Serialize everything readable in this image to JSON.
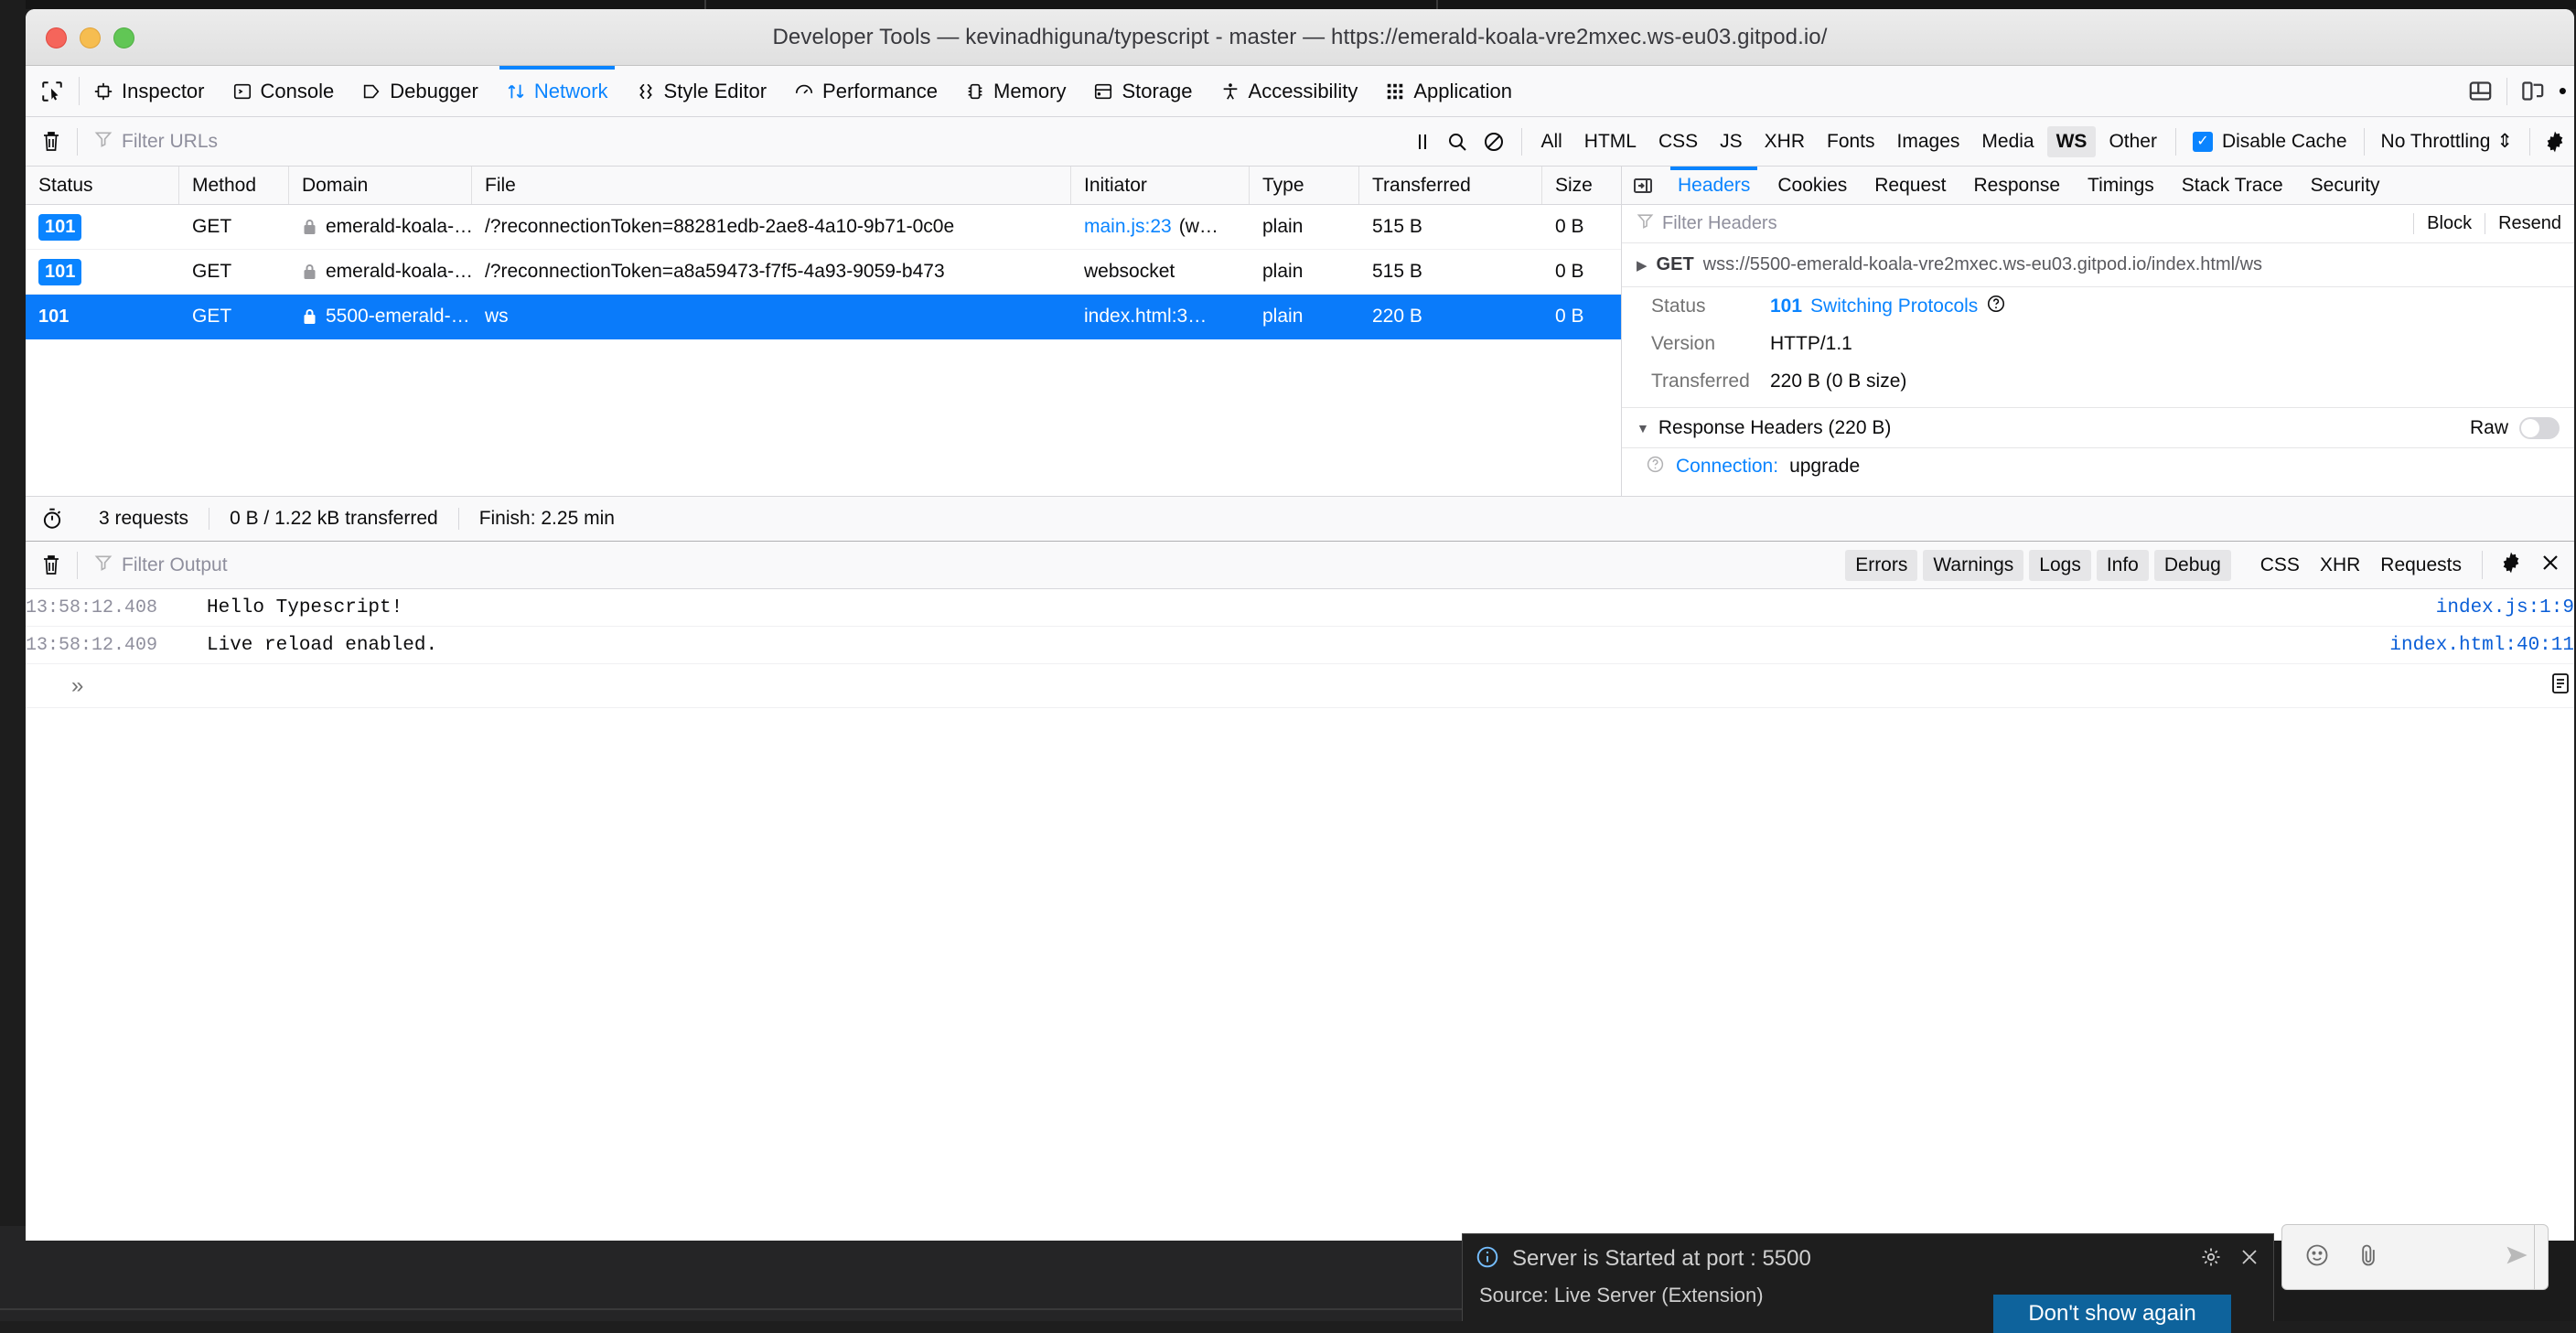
{
  "window": {
    "title": "Developer Tools — kevinadhiguna/typescript - master — https://emerald-koala-vre2mxec.ws-eu03.gitpod.io/",
    "traffic_lights": {
      "close": "close",
      "minimize": "minimize",
      "maximize": "maximize"
    }
  },
  "toolbar": {
    "picker_icon": "element-picker-icon",
    "tabs": [
      {
        "label": "Inspector",
        "icon": "inspector-icon",
        "active": false
      },
      {
        "label": "Console",
        "icon": "console-icon",
        "active": false
      },
      {
        "label": "Debugger",
        "icon": "debugger-icon",
        "active": false
      },
      {
        "label": "Network",
        "icon": "network-icon",
        "active": true
      },
      {
        "label": "Style Editor",
        "icon": "style-editor-icon",
        "active": false
      },
      {
        "label": "Performance",
        "icon": "performance-icon",
        "active": false
      },
      {
        "label": "Memory",
        "icon": "memory-icon",
        "active": false
      },
      {
        "label": "Storage",
        "icon": "storage-icon",
        "active": false
      },
      {
        "label": "Accessibility",
        "icon": "accessibility-icon",
        "active": false
      },
      {
        "label": "Application",
        "icon": "application-icon",
        "active": false
      }
    ],
    "right_icons": [
      "dock-layout-icon",
      "responsive-design-mode-icon",
      "more-options-icon"
    ],
    "accent_color": "#0a84ff"
  },
  "network_filterbar": {
    "clear_icon": "trash-icon",
    "filter_placeholder": "Filter URLs",
    "tools": [
      "pause-icon",
      "search-icon",
      "block-icon"
    ],
    "type_filters": [
      {
        "label": "All",
        "active": false
      },
      {
        "label": "HTML",
        "active": false
      },
      {
        "label": "CSS",
        "active": false
      },
      {
        "label": "JS",
        "active": false
      },
      {
        "label": "XHR",
        "active": false
      },
      {
        "label": "Fonts",
        "active": false
      },
      {
        "label": "Images",
        "active": false
      },
      {
        "label": "Media",
        "active": false
      },
      {
        "label": "WS",
        "active": true
      },
      {
        "label": "Other",
        "active": false
      }
    ],
    "disable_cache": {
      "label": "Disable Cache",
      "checked": true,
      "check_glyph": "✓"
    },
    "throttling": {
      "label": "No Throttling",
      "caret": "⇕"
    },
    "settings_icon": "gear-icon"
  },
  "request_table": {
    "columns": [
      "Status",
      "Method",
      "Domain",
      "File",
      "Initiator",
      "Type",
      "Transferred",
      "Size"
    ],
    "rows": [
      {
        "status": "101",
        "method": "GET",
        "domain": "emerald-koala-…",
        "secure": true,
        "file": "/?reconnectionToken=88281edb-2ae8-4a10-9b71-0c0e",
        "initiator": "main.js:23",
        "initiator_extra": "(w…",
        "initiator_link": true,
        "type": "plain",
        "transferred": "515 B",
        "size": "0 B",
        "selected": false
      },
      {
        "status": "101",
        "method": "GET",
        "domain": "emerald-koala-…",
        "secure": true,
        "file": "/?reconnectionToken=a8a59473-f7f5-4a93-9059-b473",
        "initiator": "websocket",
        "initiator_extra": "",
        "initiator_link": false,
        "type": "plain",
        "transferred": "515 B",
        "size": "0 B",
        "selected": false
      },
      {
        "status": "101",
        "method": "GET",
        "domain": "5500-emerald-…",
        "secure": true,
        "file": "ws",
        "initiator": "index.html:3…",
        "initiator_extra": "",
        "initiator_link": false,
        "type": "plain",
        "transferred": "220 B",
        "size": "0 B",
        "selected": true
      }
    ]
  },
  "network_status": {
    "icon": "stopwatch-icon",
    "requests": "3 requests",
    "transferred": "0 B / 1.22 kB transferred",
    "finish": "Finish: 2.25 min"
  },
  "details": {
    "toggle_icon": "collapse-sidebar-icon",
    "tabs": [
      {
        "label": "Headers",
        "active": true
      },
      {
        "label": "Cookies",
        "active": false
      },
      {
        "label": "Request",
        "active": false
      },
      {
        "label": "Response",
        "active": false
      },
      {
        "label": "Timings",
        "active": false
      },
      {
        "label": "Stack Trace",
        "active": false
      },
      {
        "label": "Security",
        "active": false
      }
    ],
    "filter_placeholder": "Filter Headers",
    "actions": [
      "Block",
      "Resend"
    ],
    "request_line": {
      "caret": "▶",
      "method": "GET",
      "url": "wss://5500-emerald-koala-vre2mxec.ws-eu03.gitpod.io/index.html/ws"
    },
    "summary": [
      {
        "key": "Status",
        "code": "101",
        "text": "Switching Protocols",
        "help": "?"
      },
      {
        "key": "Version",
        "value": "HTTP/1.1"
      },
      {
        "key": "Transferred",
        "value": "220 B (0 B size)"
      }
    ],
    "response_headers": {
      "caret": "▼",
      "title": "Response Headers (220 B)",
      "raw_label": "Raw",
      "raw_on": false,
      "rows": [
        {
          "name": "Connection:",
          "value": "upgrade",
          "help": "?"
        }
      ]
    }
  },
  "console": {
    "clear_icon": "trash-icon",
    "filter_placeholder": "Filter Output",
    "levels": [
      "Errors",
      "Warnings",
      "Logs",
      "Info",
      "Debug"
    ],
    "types": [
      "CSS",
      "XHR",
      "Requests"
    ],
    "settings_icon": "gear-icon",
    "close_icon": "close-icon",
    "logs": [
      {
        "timestamp": "13:58:12.408",
        "message": "Hello Typescript!",
        "source": "index.js:1:9"
      },
      {
        "timestamp": "13:58:12.409",
        "message": "Live reload enabled.",
        "source": "index.html:40:11"
      }
    ],
    "input_prompt": "»"
  },
  "notification": {
    "icon": "info-icon",
    "message": "Server is Started at port : 5500",
    "gear_icon": "gear-icon",
    "close_icon": "close-icon",
    "source": "Source: Live Server (Extension)",
    "button": "Don't show again"
  },
  "chatbar": {
    "icons": [
      "emoji-icon",
      "attach-icon",
      "send-icon"
    ]
  }
}
